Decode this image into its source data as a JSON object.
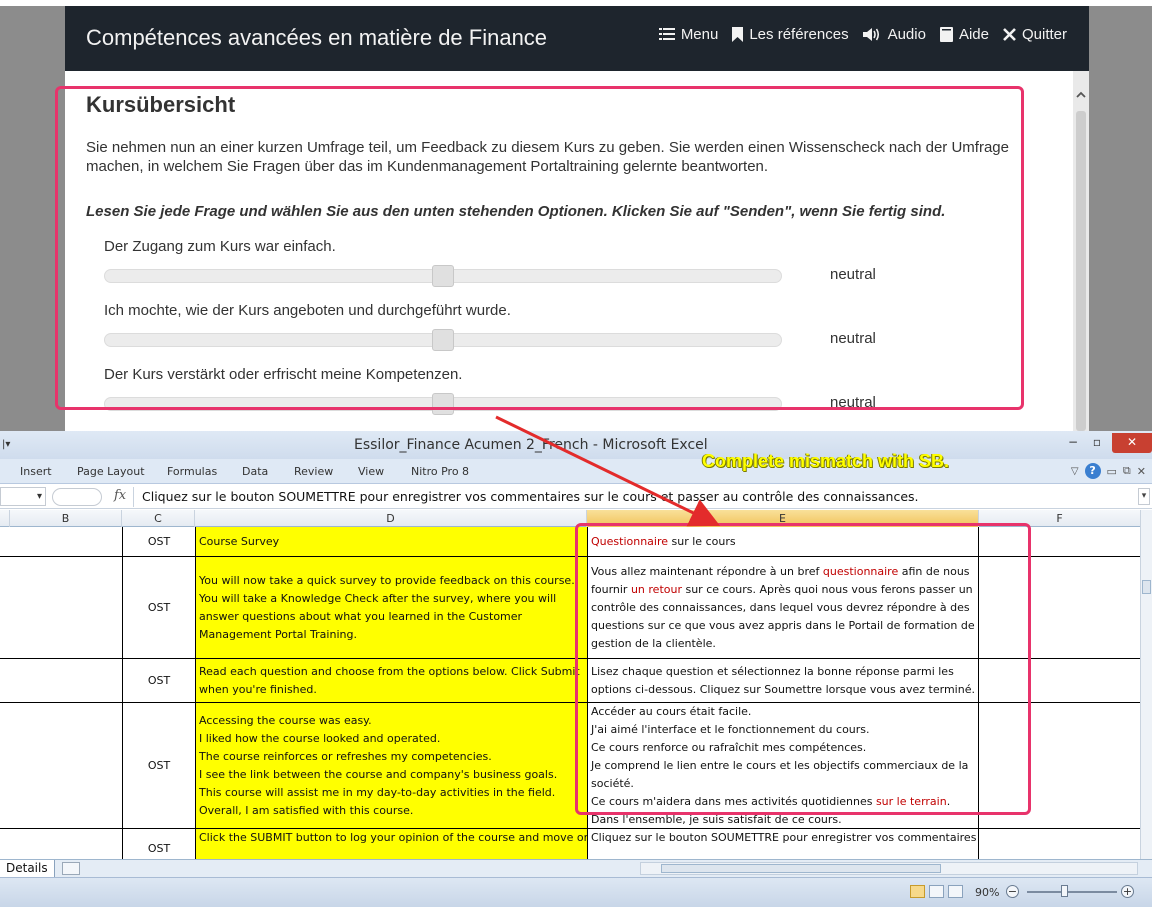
{
  "elearning": {
    "title": "Compétences avancées en matière de Finance",
    "menu": [
      {
        "label": "Menu",
        "icon": "list-icon"
      },
      {
        "label": "Les références",
        "icon": "bookmark-icon"
      },
      {
        "label": "Audio",
        "icon": "speaker-icon"
      },
      {
        "label": "Aide",
        "icon": "help-book-icon"
      },
      {
        "label": "Quitter",
        "icon": "close-icon"
      }
    ],
    "heading": "Kursübersicht",
    "intro": "Sie nehmen nun an einer kurzen Umfrage teil, um Feedback zu diesem Kurs zu geben. Sie werden einen Wissenscheck nach der Umfrage machen, in welchem Sie Fragen über das im Kundenmanagement Portaltraining gelernte beantworten.",
    "instruction": "Lesen Sie jede Frage und wählen Sie aus den unten stehenden Optionen. Klicken Sie auf \"Senden\", wenn Sie fertig sind.",
    "questions": [
      {
        "text": "Der Zugang zum Kurs war einfach.",
        "value": "neutral",
        "level": 0.5
      },
      {
        "text": "Ich mochte, wie der Kurs angeboten und durchgeführt wurde.",
        "value": "neutral",
        "level": 0.5
      },
      {
        "text": "Der Kurs verstärkt oder erfrischt meine Kompetenzen.",
        "value": "neutral",
        "level": 0.5
      }
    ]
  },
  "excel": {
    "title": "Essilor_Finance Acumen 2_French  -  Microsoft Excel",
    "ribbon_tabs": [
      "Insert",
      "Page Layout",
      "Formulas",
      "Data",
      "Review",
      "View",
      "Nitro Pro 8"
    ],
    "formula_bar": "Cliquez sur le bouton SOUMETTRE pour enregistrer vos commentaires sur le cours et passer au contrôle des connaissances.",
    "columns": [
      "B",
      "C",
      "D",
      "E",
      "F"
    ],
    "rows": [
      {
        "c": "OST",
        "d": [
          "Course Survey"
        ],
        "e": [
          [
            {
              "t": "Questionnaire",
              "hl": true
            },
            {
              "t": " sur le cours",
              "hl": false
            }
          ]
        ]
      },
      {
        "c": "OST",
        "d": [
          "You will now take a quick survey to provide feedback on this course.",
          "You will take a Knowledge Check after the survey, where you will",
          "answer questions about what you learned in the Customer",
          "Management Portal Training."
        ],
        "e": [
          [
            {
              "t": "Vous allez maintenant répondre à un bref ",
              "hl": false
            },
            {
              "t": "questionnaire",
              "hl": true
            },
            {
              "t": " afin de nous",
              "hl": false
            }
          ],
          [
            {
              "t": "fournir ",
              "hl": false
            },
            {
              "t": "un retour",
              "hl": true
            },
            {
              "t": " sur ce cours. Après quoi nous vous ferons passer un",
              "hl": false
            }
          ],
          [
            {
              "t": "contrôle des connaissances, dans lequel vous devrez répondre à des",
              "hl": false
            }
          ],
          [
            {
              "t": "questions sur ce que vous avez appris dans le Portail de formation de",
              "hl": false
            }
          ],
          [
            {
              "t": "gestion de la clientèle.",
              "hl": false
            }
          ]
        ]
      },
      {
        "c": "OST",
        "d": [
          "Read each question and choose from the options below. Click Submit",
          "when you're finished."
        ],
        "e": [
          [
            {
              "t": "Lisez chaque question et sélectionnez la bonne réponse parmi les",
              "hl": false
            }
          ],
          [
            {
              "t": "options ci-dessous. Cliquez sur Soumettre lorsque vous avez terminé.",
              "hl": false
            }
          ]
        ]
      },
      {
        "c": "OST",
        "d": [
          "Accessing the course was easy.",
          "I liked how the course looked and operated.",
          "The course reinforces or refreshes my competencies.",
          "I see the link between the course and company's business goals.",
          "This course will assist me in my day-to-day activities in the field.",
          "Overall, I am satisfied with this course."
        ],
        "e": [
          [
            {
              "t": "Accéder au cours était facile.",
              "hl": false
            }
          ],
          [
            {
              "t": "J'ai aimé l'interface et le fonctionnement du cours.",
              "hl": false
            }
          ],
          [
            {
              "t": "Ce cours renforce ou rafraîchit mes compétences.",
              "hl": false
            }
          ],
          [
            {
              "t": "Je comprend le lien entre le cours et les objectifs commerciaux de la",
              "hl": false
            }
          ],
          [
            {
              "t": "société.",
              "hl": false
            }
          ],
          [
            {
              "t": "Ce cours m'aidera dans mes activités quotidiennes ",
              "hl": false
            },
            {
              "t": "sur le terrain",
              "hl": true
            },
            {
              "t": ".",
              "hl": false
            }
          ],
          [
            {
              "t": "Dans l'ensemble, je suis satisfait de ce cours.",
              "hl": false
            }
          ]
        ]
      },
      {
        "c": "OST",
        "d": [
          "Click the SUBMIT button to log your opinion of the course and move on"
        ],
        "e": [
          [
            {
              "t": "Cliquez sur le bouton SOUMETTRE pour enregistrer vos commentaires",
              "hl": false
            }
          ]
        ]
      }
    ],
    "sheet_tab": "Details",
    "zoom": "90%"
  },
  "annotation": {
    "note": "Complete mismatch with SB.",
    "color": "#e8336b"
  }
}
